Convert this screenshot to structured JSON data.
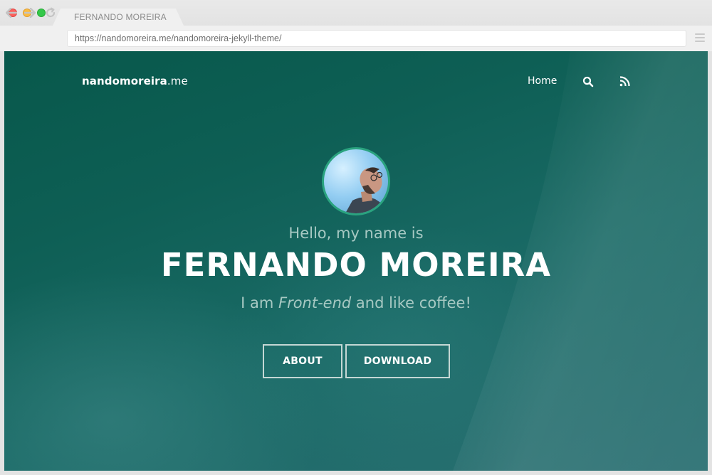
{
  "browser": {
    "tab_title": "FERNANDO MOREIRA",
    "address": "https://nandomoreira.me/nandomoreira-jekyll-theme/"
  },
  "site": {
    "brand_bold": "nandomoreira",
    "brand_suffix": ".me",
    "nav": {
      "home_label": "Home",
      "search_icon": "search-icon",
      "rss_icon": "rss-icon"
    }
  },
  "hero": {
    "greeting": "Hello, my name is",
    "name": "FERNANDO MOREIRA",
    "tagline_prefix": "I am ",
    "tagline_em": "Front-end",
    "tagline_suffix": " and like coffee!",
    "buttons": {
      "about": "ABOUT",
      "download": "DOWNLOAD"
    }
  },
  "colors": {
    "background": "#0e5f55",
    "avatar_ring": "#2aa37f",
    "muted_text": "#a7c9c3"
  }
}
